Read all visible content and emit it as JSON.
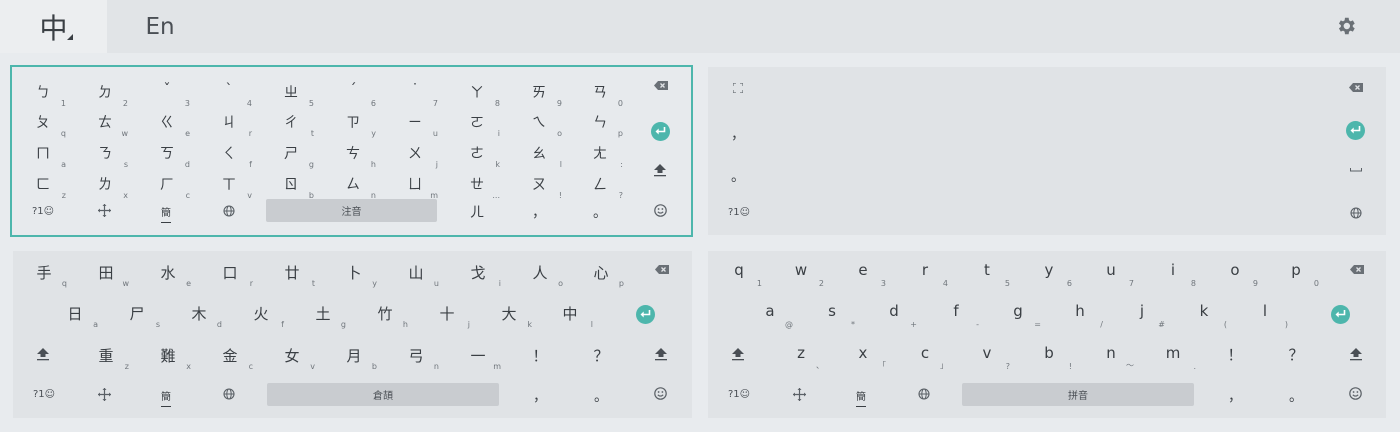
{
  "tabs": {
    "zh": "中",
    "en": "En"
  },
  "zhuyin": {
    "rows": [
      [
        [
          "ㄅ",
          "1"
        ],
        [
          "ㄉ",
          "2"
        ],
        [
          "ˇ",
          "3"
        ],
        [
          "ˋ",
          "4"
        ],
        [
          "ㄓ",
          "5"
        ],
        [
          "ˊ",
          "6"
        ],
        [
          "˙",
          "7"
        ],
        [
          "ㄚ",
          "8"
        ],
        [
          "ㄞ",
          "9"
        ],
        [
          "ㄢ",
          "0"
        ]
      ],
      [
        [
          "ㄆ",
          "q"
        ],
        [
          "ㄊ",
          "w"
        ],
        [
          "ㄍ",
          "e"
        ],
        [
          "ㄐ",
          "r"
        ],
        [
          "ㄔ",
          "t"
        ],
        [
          "ㄗ",
          "y"
        ],
        [
          "ㄧ",
          "u"
        ],
        [
          "ㄛ",
          "i"
        ],
        [
          "ㄟ",
          "o"
        ],
        [
          "ㄣ",
          "p"
        ]
      ],
      [
        [
          "ㄇ",
          "a"
        ],
        [
          "ㄋ",
          "s"
        ],
        [
          "ㄎ",
          "d"
        ],
        [
          "ㄑ",
          "f"
        ],
        [
          "ㄕ",
          "g"
        ],
        [
          "ㄘ",
          "h"
        ],
        [
          "ㄨ",
          "j"
        ],
        [
          "ㄜ",
          "k"
        ],
        [
          "ㄠ",
          "l"
        ],
        [
          "ㄤ",
          ":"
        ]
      ],
      [
        [
          "ㄈ",
          "z"
        ],
        [
          "ㄌ",
          "x"
        ],
        [
          "ㄏ",
          "c"
        ],
        [
          "ㄒ",
          "v"
        ],
        [
          "ㄖ",
          "b"
        ],
        [
          "ㄙ",
          "n"
        ],
        [
          "ㄩ",
          "m"
        ],
        [
          "ㄝ",
          "..."
        ],
        [
          "ㄡ",
          "!"
        ],
        [
          "ㄥ",
          "?"
        ]
      ]
    ],
    "bottom": {
      "sym": "?1☺",
      "jian": "簡",
      "space": "注音",
      "k1": "ㄦ",
      "k2": "，",
      "k3": "。"
    }
  },
  "side": {
    "comma": "，",
    "period": "。",
    "sym": "?1☺"
  },
  "cangjie": {
    "row1": [
      [
        "手",
        "q"
      ],
      [
        "田",
        "w"
      ],
      [
        "水",
        "e"
      ],
      [
        "口",
        "r"
      ],
      [
        "廿",
        "t"
      ],
      [
        "卜",
        "y"
      ],
      [
        "山",
        "u"
      ],
      [
        "戈",
        "i"
      ],
      [
        "人",
        "o"
      ],
      [
        "心",
        "p"
      ]
    ],
    "row2": [
      [
        "日",
        "a"
      ],
      [
        "尸",
        "s"
      ],
      [
        "木",
        "d"
      ],
      [
        "火",
        "f"
      ],
      [
        "土",
        "g"
      ],
      [
        "竹",
        "h"
      ],
      [
        "十",
        "j"
      ],
      [
        "大",
        "k"
      ],
      [
        "中",
        "l"
      ]
    ],
    "row3": [
      [
        "重",
        "z"
      ],
      [
        "難",
        "x"
      ],
      [
        "金",
        "c"
      ],
      [
        "女",
        "v"
      ],
      [
        "月",
        "b"
      ],
      [
        "弓",
        "n"
      ],
      [
        "一",
        "m"
      ],
      [
        "！",
        ""
      ],
      [
        "？",
        ""
      ]
    ],
    "bottom": {
      "sym": "?1☺",
      "jian": "簡",
      "space": "倉頡",
      "k1": "，",
      "k2": "。"
    }
  },
  "pinyin": {
    "row1": [
      [
        "q",
        "1"
      ],
      [
        "w",
        "2"
      ],
      [
        "e",
        "3"
      ],
      [
        "r",
        "4"
      ],
      [
        "t",
        "5"
      ],
      [
        "y",
        "6"
      ],
      [
        "u",
        "7"
      ],
      [
        "i",
        "8"
      ],
      [
        "o",
        "9"
      ],
      [
        "p",
        "0"
      ]
    ],
    "row2": [
      [
        "a",
        "@"
      ],
      [
        "s",
        "*"
      ],
      [
        "d",
        "+"
      ],
      [
        "f",
        "-"
      ],
      [
        "g",
        "="
      ],
      [
        "h",
        "/"
      ],
      [
        "j",
        "#"
      ],
      [
        "k",
        "("
      ],
      [
        "l",
        ")"
      ]
    ],
    "row3": [
      [
        "z",
        "、"
      ],
      [
        "x",
        "「"
      ],
      [
        "c",
        "」"
      ],
      [
        "v",
        "?"
      ],
      [
        "b",
        "!"
      ],
      [
        "n",
        "～"
      ],
      [
        "m",
        "."
      ],
      [
        "！",
        ""
      ],
      [
        "？",
        ""
      ]
    ],
    "bottom": {
      "sym": "?1☺",
      "jian": "簡",
      "space": "拼音",
      "k1": "，",
      "k2": "。"
    }
  },
  "colors": {
    "accent": "#4db6ac",
    "panel": "#e0e3e6",
    "key_text": "#3a3f44"
  },
  "icons": [
    "gear-icon",
    "backspace-icon",
    "enter-icon",
    "shift-icon",
    "move-cursor-icon",
    "globe-icon",
    "emoji-icon",
    "fullscreen-icon",
    "space-icon"
  ]
}
